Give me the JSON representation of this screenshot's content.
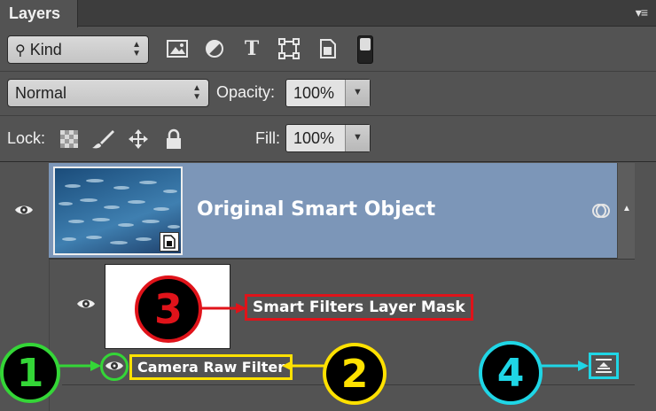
{
  "panel": {
    "tab_label": "Layers",
    "menu_glyph": "▾≡"
  },
  "filter_row": {
    "kind_dropdown": {
      "selected": "Kind",
      "search_glyph": "⚲"
    },
    "filter_icons": [
      "image-filter-icon",
      "adjustment-filter-icon",
      "type-filter-icon",
      "shape-filter-icon",
      "smart-object-filter-icon"
    ],
    "type_glyph": "T"
  },
  "blend_row": {
    "blend_mode": "Normal",
    "opacity_label": "Opacity:",
    "opacity_value": "100%"
  },
  "lock_row": {
    "lock_label": "Lock:",
    "fill_label": "Fill:",
    "fill_value": "100%"
  },
  "layers": {
    "smart_object_name": "Original Smart Object"
  },
  "annotations": {
    "callout_1": "1",
    "callout_2": "2",
    "callout_3": "3",
    "callout_4": "4",
    "mask_label": "Smart Filters Layer Mask",
    "filter_label": "Camera Raw Filter",
    "colors": {
      "green": "#34d637",
      "yellow": "#ffe100",
      "red": "#e0131a",
      "cyan": "#1fd6e6",
      "selection": "#7c96b8"
    }
  }
}
